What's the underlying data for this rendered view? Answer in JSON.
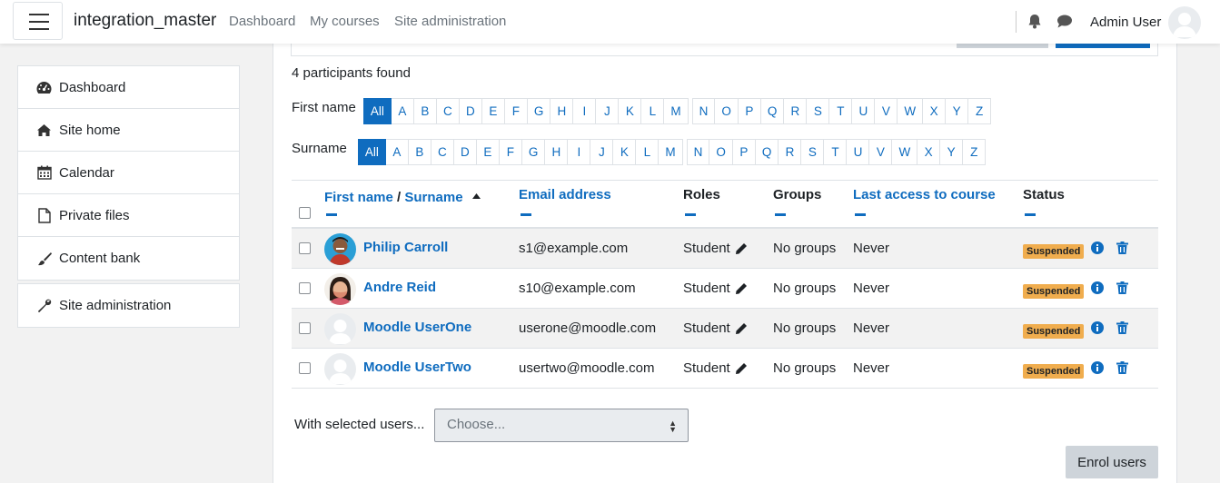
{
  "navbar": {
    "site_name": "integration_master",
    "links": [
      "Dashboard",
      "My courses",
      "Site administration"
    ],
    "user_name": "Admin User"
  },
  "drawer": {
    "items": [
      {
        "label": "Dashboard",
        "icon": "dashboard-icon"
      },
      {
        "label": "Site home",
        "icon": "home-icon"
      },
      {
        "label": "Calendar",
        "icon": "calendar-icon"
      },
      {
        "label": "Private files",
        "icon": "file-icon"
      },
      {
        "label": "Content bank",
        "icon": "paint-brush-icon"
      }
    ],
    "admin_item": {
      "label": "Site administration",
      "icon": "wrench-icon"
    }
  },
  "participants": {
    "found_text": "4 participants found",
    "firstname_label": "First name",
    "surname_label": "Surname",
    "all_label": "All",
    "letters_a_m": [
      "A",
      "B",
      "C",
      "D",
      "E",
      "F",
      "G",
      "H",
      "I",
      "J",
      "K",
      "L",
      "M"
    ],
    "letters_n_z": [
      "N",
      "O",
      "P",
      "Q",
      "R",
      "S",
      "T",
      "U",
      "V",
      "W",
      "X",
      "Y",
      "Z"
    ]
  },
  "table": {
    "headers": {
      "firstname": "First name",
      "separator": "/",
      "surname": "Surname",
      "email": "Email address",
      "roles": "Roles",
      "groups": "Groups",
      "last_access": "Last access to course",
      "status": "Status"
    },
    "rows": [
      {
        "name": "Philip Carroll",
        "email": "s1@example.com",
        "role": "Student",
        "groups": "No groups",
        "last_access": "Never",
        "status": "Suspended",
        "avatar": "photo-1"
      },
      {
        "name": "Andre Reid",
        "email": "s10@example.com",
        "role": "Student",
        "groups": "No groups",
        "last_access": "Never",
        "status": "Suspended",
        "avatar": "photo-2"
      },
      {
        "name": "Moodle UserOne",
        "email": "userone@moodle.com",
        "role": "Student",
        "groups": "No groups",
        "last_access": "Never",
        "status": "Suspended",
        "avatar": "default"
      },
      {
        "name": "Moodle UserTwo",
        "email": "usertwo@moodle.com",
        "role": "Student",
        "groups": "No groups",
        "last_access": "Never",
        "status": "Suspended",
        "avatar": "default"
      }
    ]
  },
  "bulk": {
    "label": "With selected users...",
    "select_value": "Choose..."
  },
  "enrol_button": "Enrol users",
  "colors": {
    "accent": "#0f6cbf",
    "badge": "#f0ad4e",
    "page_bg": "#f2f2f2"
  }
}
